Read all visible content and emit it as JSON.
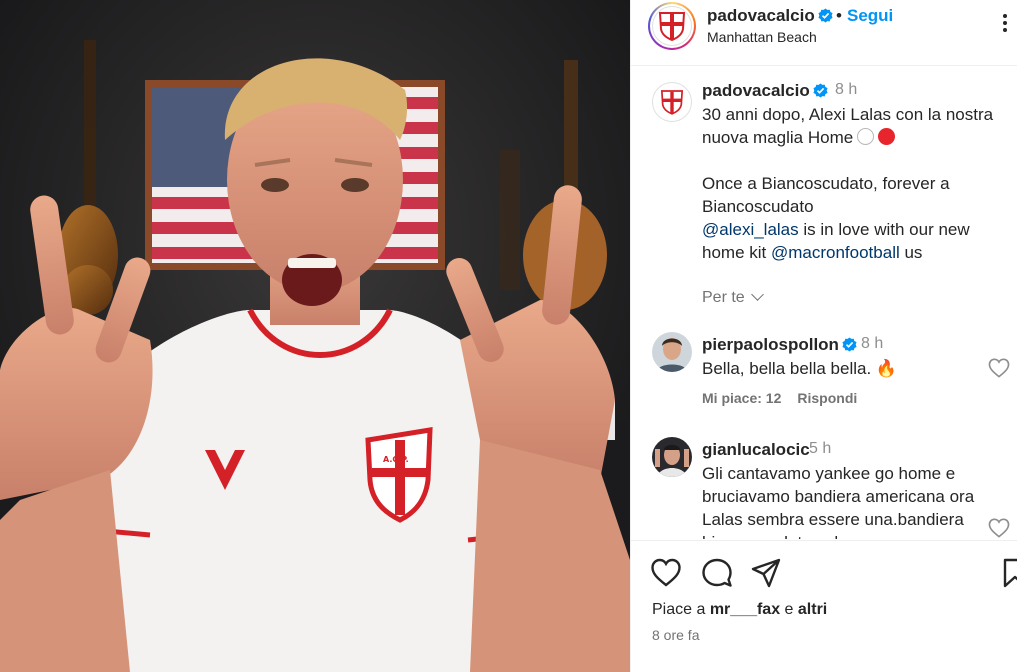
{
  "post": {
    "username": "padovacalcio",
    "follow_label": "Segui",
    "location": "Manhattan Beach",
    "time": "8 h",
    "caption": {
      "line1": "30 anni dopo, Alexi Lalas con la nostra",
      "line2": "nuova maglia Home",
      "line3": "Once a Biancoscudato, forever a",
      "line4": "Biancoscudato",
      "mention1": "@alexi_lalas",
      "line5_rest": " is in love with our new",
      "line6_start": "home kit ",
      "mention2": "@macronfootball",
      "line6_end": " us"
    },
    "translate_label": "Per te",
    "badge": "A.C.P."
  },
  "comments": [
    {
      "username": "pierpaolospollon",
      "verified": true,
      "time": "8 h",
      "lines": [
        "Bella, bella bella bella. 🔥"
      ],
      "likes_label": "Mi piace: 12",
      "reply_label": "Rispondi"
    },
    {
      "username": "gianlucalocic",
      "verified": false,
      "time": "5 h",
      "lines": [
        "Gli cantavamo yankee go home e",
        "bruciavamo bandiera americana ora",
        "Lalas sembra essere una.bandiera",
        "biancoscudata solo per aver"
      ]
    }
  ],
  "footer": {
    "likes_prefix": "Piace a ",
    "likes_user": "mr___fax",
    "likes_mid": " e ",
    "likes_others": "altri",
    "time_ago": "8 ore fa"
  },
  "icons": {
    "verified": "verified-badge-icon",
    "more": "more-options-icon",
    "like": "heart-icon",
    "comment": "comment-icon",
    "share": "share-icon",
    "save": "bookmark-icon"
  },
  "colors": {
    "accent": "#0095f6",
    "verified": "#0095f6",
    "club_red": "#d42027",
    "mention": "#00376b",
    "secondary_text": "#737373"
  }
}
